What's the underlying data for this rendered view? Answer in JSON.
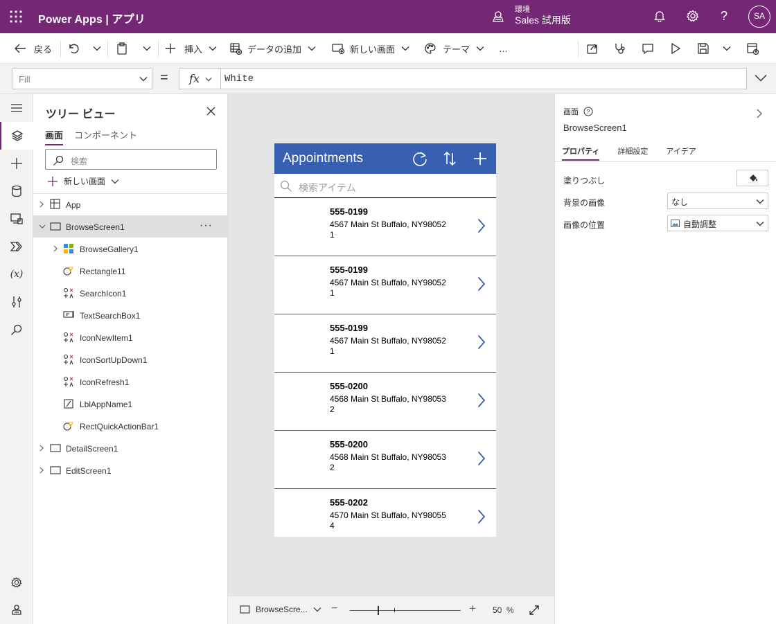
{
  "header": {
    "brand": "Power Apps | アプリ",
    "env_label": "環境",
    "env_name": "Sales 試用版",
    "avatar": "SA",
    "icons": [
      "waffle-icon",
      "environment-icon",
      "bell-icon",
      "gear-icon",
      "help-icon"
    ]
  },
  "toolbar": {
    "back": "戻る",
    "insert": "挿入",
    "add_data": "データの追加",
    "new_screen": "新しい画面",
    "theme": "テーマ",
    "more": "…",
    "icons": [
      "undo-icon",
      "paste-icon",
      "share-icon",
      "app-checker-icon",
      "comment-icon",
      "play-icon",
      "save-icon",
      "publish-icon"
    ]
  },
  "formula_bar": {
    "property": "Fill",
    "fx": "fx",
    "equals": "=",
    "value": "White"
  },
  "tree": {
    "title": "ツリー ビュー",
    "tabs": [
      "画面",
      "コンポーネント"
    ],
    "search_placeholder": "検索",
    "new_screen": "新しい画面",
    "nodes": [
      {
        "label": "App",
        "icon": "app-icon"
      },
      {
        "label": "BrowseScreen1",
        "icon": "screen-icon",
        "selected": true
      },
      {
        "label": "BrowseGallery1",
        "icon": "gallery-icon"
      },
      {
        "label": "Rectangle11",
        "icon": "shape-icon"
      },
      {
        "label": "SearchIcon1",
        "icon": "icon-control-icon"
      },
      {
        "label": "TextSearchBox1",
        "icon": "textinput-icon"
      },
      {
        "label": "IconNewItem1",
        "icon": "icon-control-icon"
      },
      {
        "label": "IconSortUpDown1",
        "icon": "icon-control-icon"
      },
      {
        "label": "IconRefresh1",
        "icon": "icon-control-icon"
      },
      {
        "label": "LblAppName1",
        "icon": "label-icon"
      },
      {
        "label": "RectQuickActionBar1",
        "icon": "shape-icon"
      },
      {
        "label": "DetailScreen1",
        "icon": "screen-icon"
      },
      {
        "label": "EditScreen1",
        "icon": "screen-icon"
      }
    ]
  },
  "app": {
    "title": "Appointments",
    "search_placeholder": "検索アイテム",
    "items": [
      {
        "phone": "555-0199",
        "address": "4567 Main St Buffalo, NY98052",
        "id": "1"
      },
      {
        "phone": "555-0199",
        "address": "4567 Main St Buffalo, NY98052",
        "id": "1"
      },
      {
        "phone": "555-0199",
        "address": "4567 Main St Buffalo, NY98052",
        "id": "1"
      },
      {
        "phone": "555-0200",
        "address": "4568 Main St Buffalo, NY98053",
        "id": "2"
      },
      {
        "phone": "555-0200",
        "address": "4568 Main St Buffalo, NY98053",
        "id": "2"
      },
      {
        "phone": "555-0202",
        "address": "4570 Main St Buffalo, NY98055",
        "id": "4"
      }
    ],
    "accent": "#3860b2"
  },
  "zoom": {
    "screen": "BrowseScre...",
    "value": "50",
    "unit": "%"
  },
  "properties": {
    "kind": "画面",
    "name": "BrowseScreen1",
    "tabs": [
      "プロパティ",
      "詳細設定",
      "アイデア"
    ],
    "fill_label": "塗りつぶし",
    "bg_image_label": "背景の画像",
    "bg_image_value": "なし",
    "image_pos_label": "画像の位置",
    "image_pos_value": "自動調整"
  },
  "colors": {
    "brand": "#742774",
    "app_header": "#3860b2"
  }
}
